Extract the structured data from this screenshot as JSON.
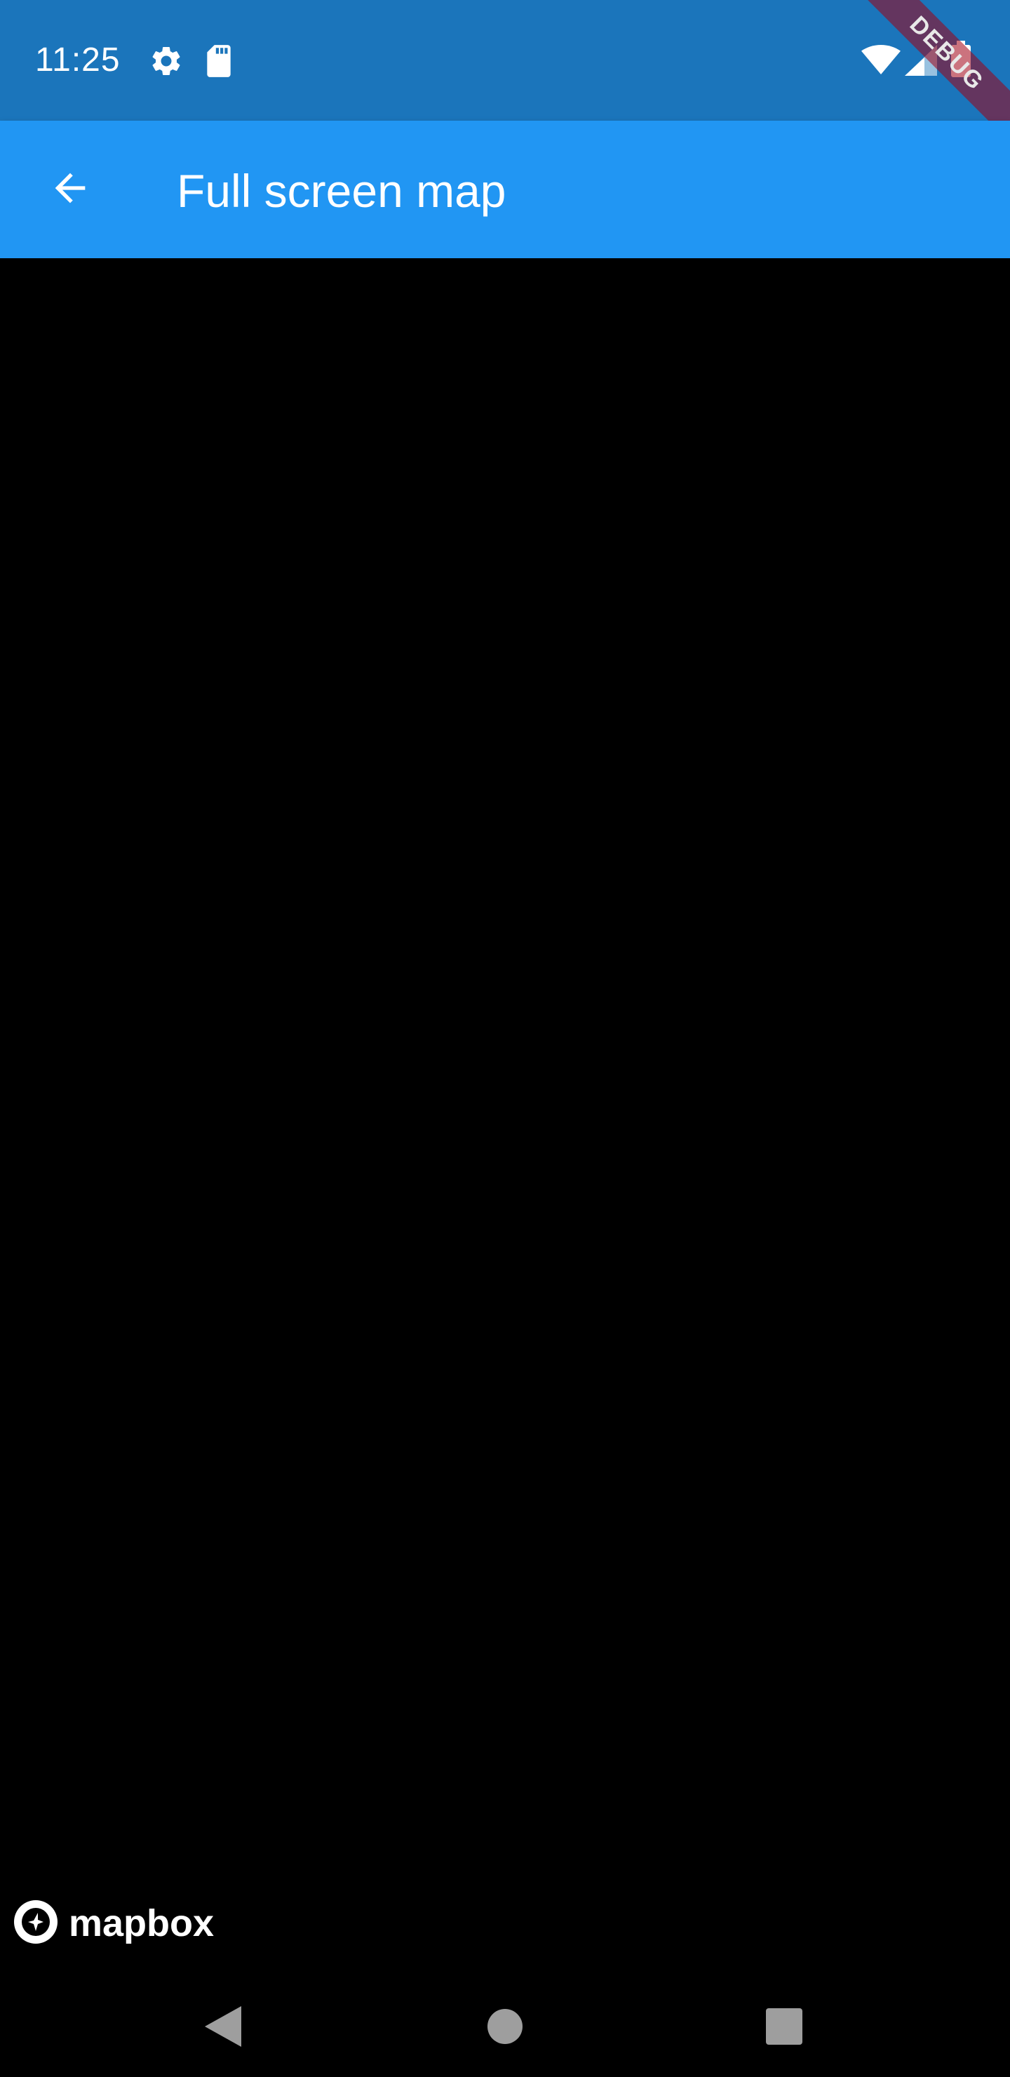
{
  "status_bar": {
    "time": "11:25",
    "icons": [
      "settings-icon",
      "sd-card-icon",
      "wifi-icon",
      "cellular-signal-icon",
      "battery-icon"
    ]
  },
  "app_bar": {
    "title": "Full screen map",
    "back_icon": "arrow-back-icon"
  },
  "map": {
    "attribution": "mapbox"
  },
  "debug_banner": {
    "label": "DEBUG"
  },
  "nav_bar": {
    "buttons": [
      "back-triangle-icon",
      "home-circle-icon",
      "recents-square-icon"
    ]
  },
  "colors": {
    "status_bar": "#1B75BB",
    "app_bar": "#2196F3",
    "map_background": "#000000",
    "nav_icons": "#9E9E9E"
  }
}
